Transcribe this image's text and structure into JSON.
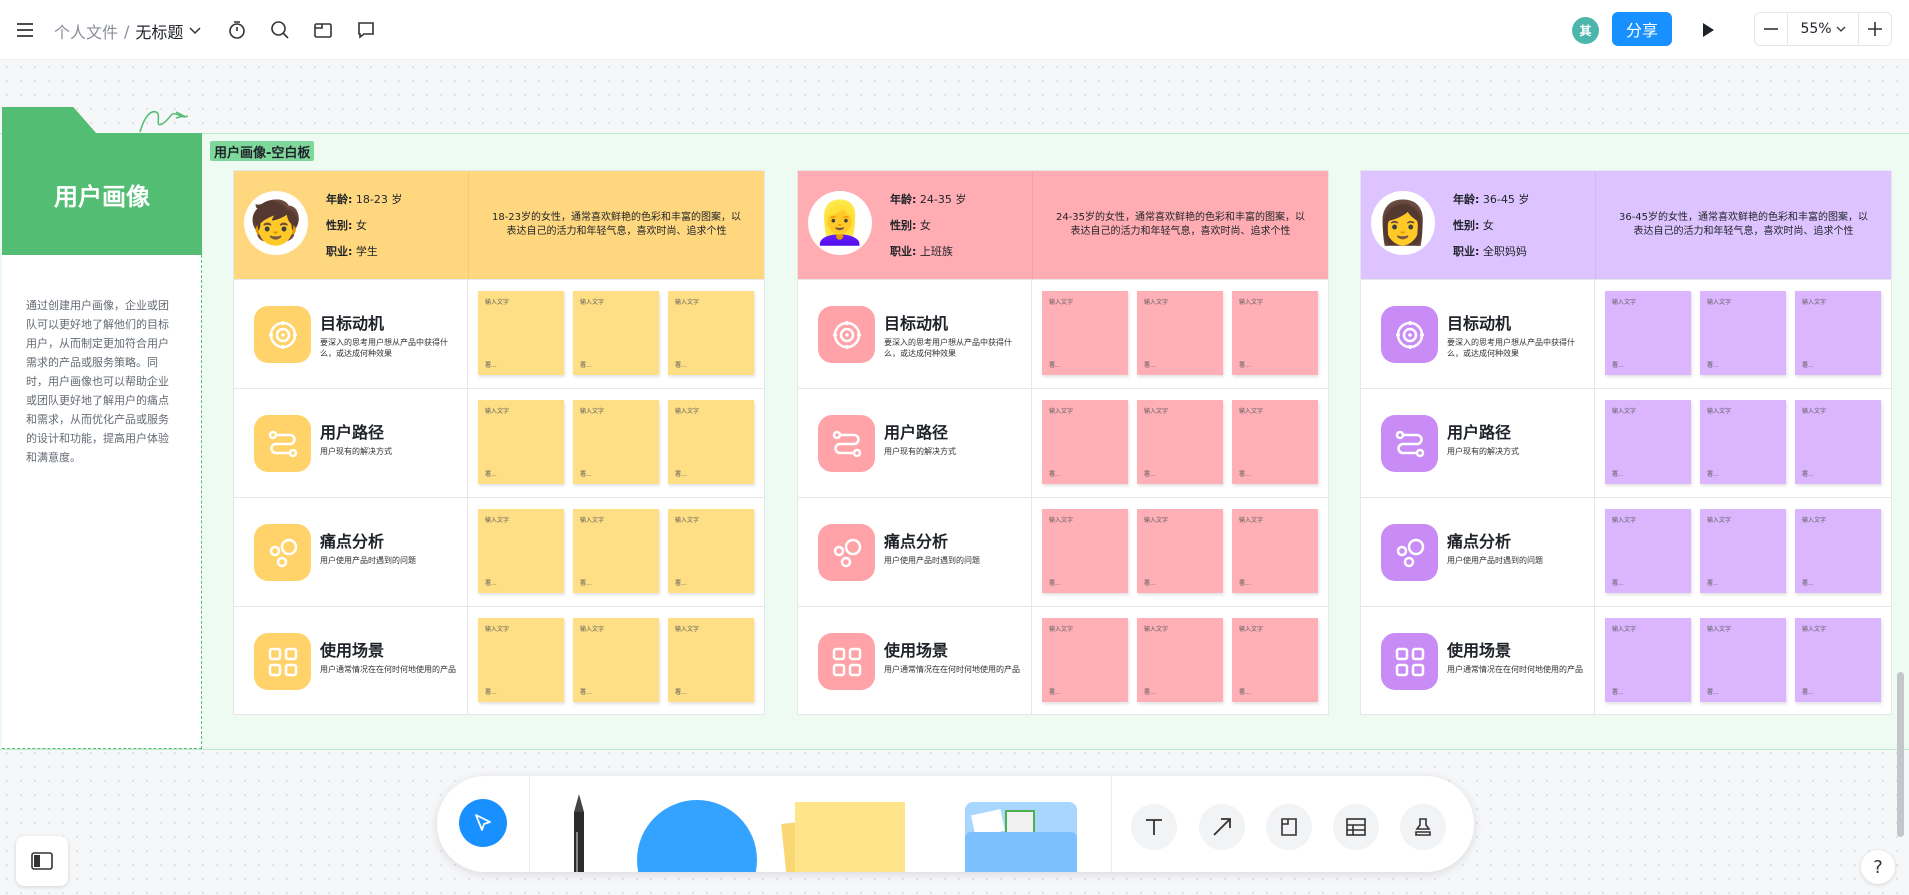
{
  "topbar": {
    "breadcrumb_root": "个人文件",
    "breadcrumb_sep": "/",
    "breadcrumb_current": "无标题",
    "avatar_initial": "其",
    "share_label": "分享",
    "zoom": "55%",
    "icons": [
      "menu-icon",
      "timer-icon",
      "search-icon",
      "folder-icon",
      "comment-icon",
      "play-icon",
      "zoom-out-icon",
      "zoom-in-icon"
    ]
  },
  "left_panel": {
    "title": "用户画像",
    "text": "通过创建用户画像，企业或团队可以更好地了解他们的目标用户，从而制定更加符合用户需求的产品或服务策略。同时，用户画像也可以帮助企业或团队更好地了解用户的痛点和需求，从而优化产品或服务的设计和功能，提高用户体验和满意度。"
  },
  "board_tag": "用户画像-空白板",
  "labels": {
    "age": "年龄:",
    "gender": "性别:",
    "job": "职业:",
    "note_placeholder": "输入文字",
    "note_footer": "署..."
  },
  "rows": [
    {
      "title": "目标动机",
      "desc": "要深入的思考用户想从产品中获得什么，或达成何种效果",
      "icon": "target-icon"
    },
    {
      "title": "用户路径",
      "desc": "用户现有的解决方式",
      "icon": "route-icon"
    },
    {
      "title": "痛点分析",
      "desc": "用户使用产品时遇到的问题",
      "icon": "bubbles-icon"
    },
    {
      "title": "使用场景",
      "desc": "用户通常情况在在何时何地使用的产品",
      "icon": "grid-icon"
    }
  ],
  "personas": [
    {
      "age": "18-23 岁",
      "gender": "女",
      "job": "学生",
      "desc": "18-23岁的女性，通常喜欢鲜艳的色彩和丰富的图案，以表达自己的活力和年轻气息，喜欢时尚、追求个性",
      "header_color": "#ffd77f",
      "note_color": "#ffdf85",
      "icon_color": "#ffd36a",
      "face": "🧒"
    },
    {
      "age": "24-35 岁",
      "gender": "女",
      "job": "上班族",
      "desc": "24-35岁的女性，通常喜欢鲜艳的色彩和丰富的图案，以表达自己的活力和年轻气息，喜欢时尚、追求个性",
      "header_color": "#ffadb3",
      "note_color": "#ffb0b7",
      "icon_color": "#ffa3a9",
      "face": "👱‍♀️"
    },
    {
      "age": "36-45 岁",
      "gender": "女",
      "job": "全职妈妈",
      "desc": "36-45岁的女性，通常喜欢鲜艳的色彩和丰富的图案，以表达自己的活力和年轻气息，喜欢时尚、追求个性",
      "header_color": "#ddc3ff",
      "note_color": "#dbb6ff",
      "icon_color": "#c98cf7",
      "face": "👩"
    }
  ]
}
